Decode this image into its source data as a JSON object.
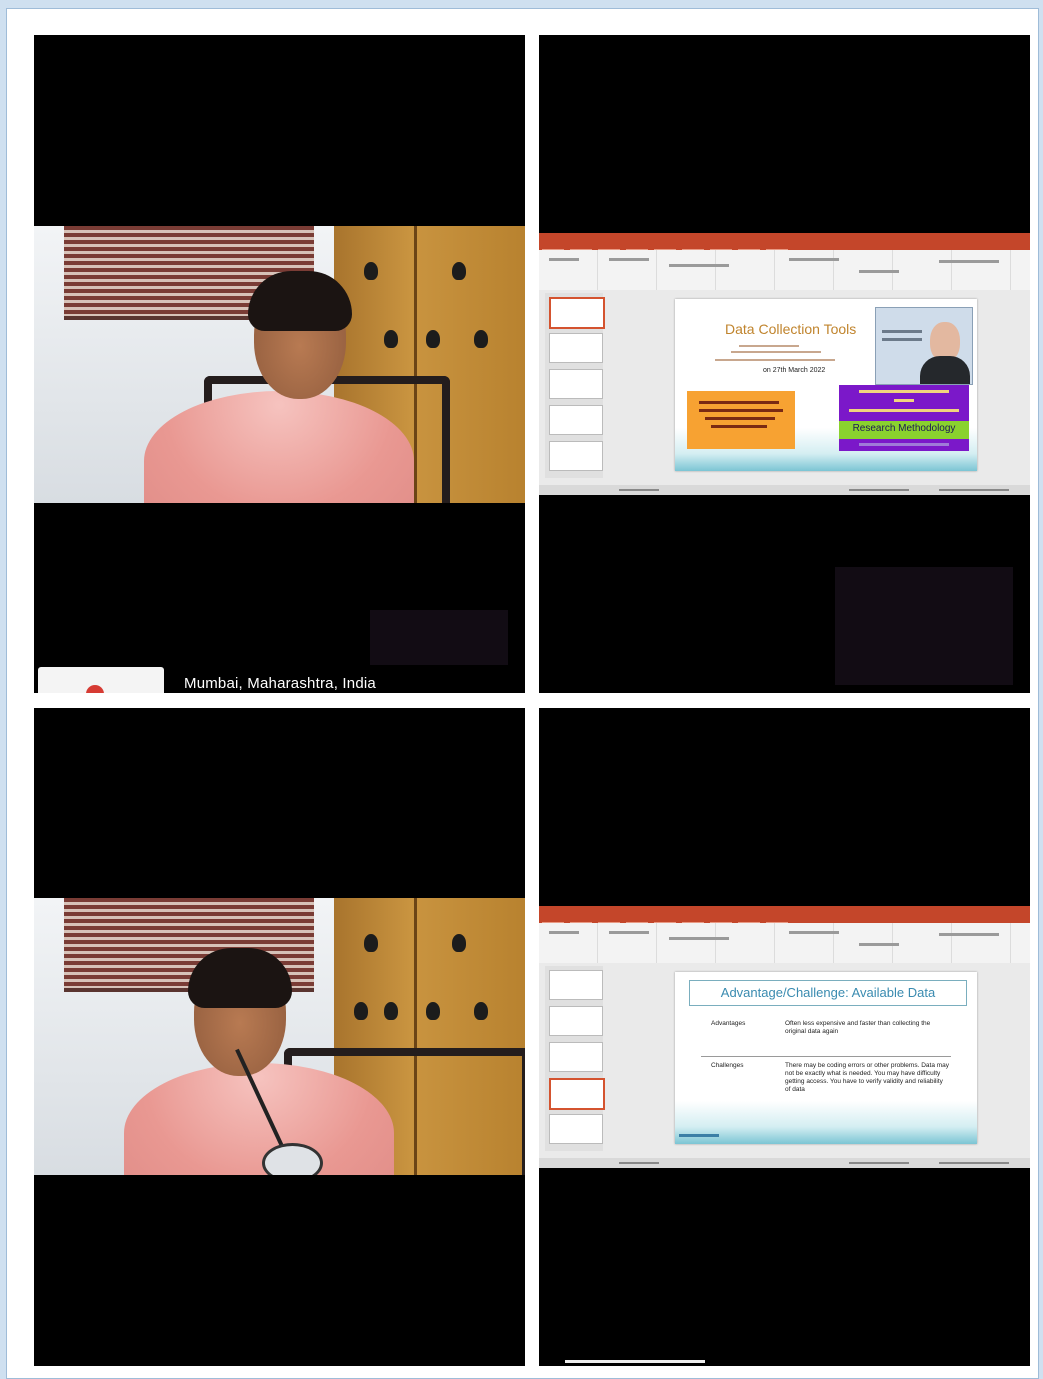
{
  "tiles": [
    {
      "kind": "camera",
      "location_label": "Mumbai, Maharashtra, India"
    },
    {
      "kind": "screen-share",
      "slide": 1
    },
    {
      "kind": "camera",
      "location_label": ""
    },
    {
      "kind": "screen-share",
      "slide": 2
    }
  ],
  "slide1": {
    "title": "Data Collection Tools",
    "date_text": "on 27th March 2022",
    "workshop_topic": "Research Methodology"
  },
  "slide2": {
    "title": "Advantage/Challenge: Available Data",
    "rows": [
      {
        "label": "Advantages",
        "text": "Often less expensive and faster than collecting the original data again"
      },
      {
        "label": "Challenges",
        "text": "There may be coding errors or other problems. Data may not be exactly what is needed. You may have difficulty getting access. You have to verify validity and reliability of data"
      }
    ]
  },
  "colors": {
    "tile_bg": "#000000",
    "ppt_accent": "#c4462a",
    "slide1_title": "#c0842d",
    "slide2_title": "#3a8bb0",
    "rec_dot": "#d63b33"
  },
  "icons": [
    "record-dot-icon"
  ]
}
